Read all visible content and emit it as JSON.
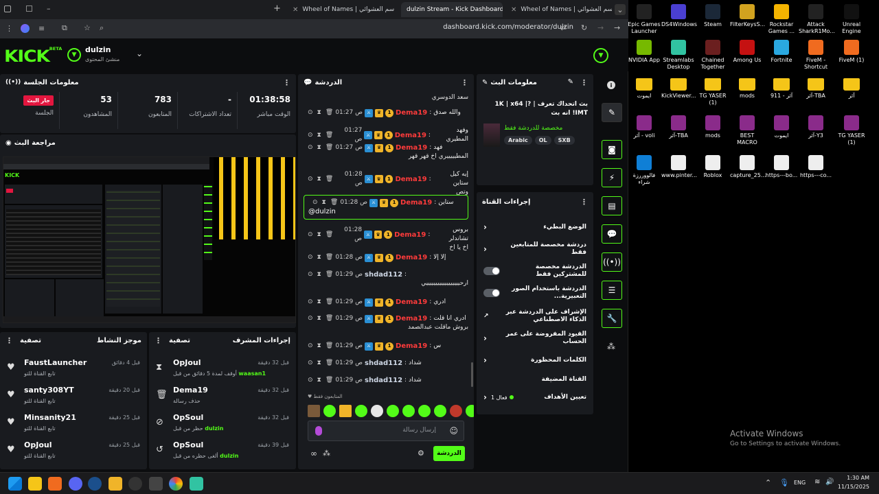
{
  "browser": {
    "tabs": [
      {
        "title": "Wheel of Names | سم العشوائي",
        "active": false
      },
      {
        "title": "dulzin Stream - Kick Dashboard",
        "active": true
      },
      {
        "title": "Wheel of Names | سم العشوائي",
        "active": false
      }
    ],
    "url": "dashboard.kick.com/moderator/dulzin"
  },
  "header": {
    "logo": "KICK",
    "logo_sup": "BETA",
    "channel": "dulzin",
    "role": "منشئ المحتوى"
  },
  "session": {
    "title": "معلومات الجلسة",
    "stats": [
      {
        "value": "01:38:58",
        "label": "الوقت مباشر"
      },
      {
        "value": "-",
        "label": "تعداد الاشتراكات"
      },
      {
        "value": "783",
        "label": "المتابعون"
      },
      {
        "value": "53",
        "label": "المشاهدون"
      },
      {
        "value": "جار البث",
        "label": "الجلسة"
      }
    ]
  },
  "preview": {
    "title": "مراجعة البث"
  },
  "activity": {
    "title": "موجز النشاط",
    "filter": "تصفية",
    "items": [
      {
        "name": "FaustLauncher",
        "sub": "تابع القناة للتو",
        "time": "قبل 4 دقائق",
        "icon": "heart-icon"
      },
      {
        "name": "santy308YT",
        "sub": "تابع القناة للتو",
        "time": "قبل 20 دقيقة",
        "icon": "heart-icon"
      },
      {
        "name": "Minsanity21",
        "sub": "تابع القناة للتو",
        "time": "قبل 25 دقيقة",
        "icon": "heart-icon"
      },
      {
        "name": "OpJoul",
        "sub": "تابع القناة للتو",
        "time": "قبل 25 دقيقة",
        "icon": "heart-icon"
      }
    ]
  },
  "mod": {
    "title": "إجراءات المشرف",
    "filter": "تصفية",
    "items": [
      {
        "name": "OpJoul",
        "sub": "أوقف لمدة 5 دقائق من قبل",
        "target": "waasan1",
        "time": "قبل 32 دقيقة",
        "icon": "hourglass-icon"
      },
      {
        "name": "Dema19",
        "sub": "حذف رسالة",
        "target": "",
        "time": "قبل 32 دقيقة",
        "icon": "trash-icon"
      },
      {
        "name": "OpSoul",
        "sub": "حظر من قبل",
        "target": "dulzin",
        "time": "قبل 32 دقيقة",
        "icon": "ban-icon"
      },
      {
        "name": "OpSoul",
        "sub": "ألغى حظره من قبل",
        "target": "dulzin",
        "time": "قبل 39 دقيقة",
        "icon": "undo-icon"
      }
    ]
  },
  "chat": {
    "title": "الدردشة",
    "top_text": "سعد الدوسري",
    "messages": [
      {
        "user": "Dema19",
        "color": "#ff3b3b",
        "time": "01:27 ص",
        "text": "والله صدق",
        "badges": true
      },
      {
        "user": "Dema19",
        "color": "#ff3b3b",
        "time": "01:27 ص",
        "text": "وفهد المطيري",
        "badges": true
      },
      {
        "user": "Dema19",
        "color": "#ff3b3b",
        "time": "01:27 ص",
        "text": "فهد",
        "cont": "المطيييييري اخ قهر قهر",
        "badges": true
      },
      {
        "user": "Dema19",
        "color": "#ff3b3b",
        "time": "01:28 ص",
        "text": "إيه كيل ستاين",
        "cont": "وتص",
        "badges": true
      },
      {
        "user": "Dema19",
        "color": "#ff3b3b",
        "time": "01:28 ص",
        "text": "ستاين",
        "cont": "@dulzin",
        "badges": true,
        "highlight": true
      },
      {
        "user": "Dema19",
        "color": "#ff3b3b",
        "time": "01:28 ص",
        "text": "بروس تشاندلر",
        "cont": "اخ يا اخ",
        "badges": true
      },
      {
        "user": "Dema19",
        "color": "#ff3b3b",
        "time": "01:28 ص",
        "text": "إلا إلا",
        "badges": true
      },
      {
        "user": "shdad112",
        "color": "#cfd8e6",
        "time": "01:29 ص",
        "text": "",
        "cont": "ارحييييييييييييييييييي",
        "badges": false
      },
      {
        "user": "Dema19",
        "color": "#ff3b3b",
        "time": "01:29 ص",
        "text": "ادري",
        "badges": true
      },
      {
        "user": "Dema19",
        "color": "#ff3b3b",
        "time": "01:29 ص",
        "text": "ادري انا قلت",
        "cont": "بروش ماقلت عبدالصمد",
        "badges": true
      },
      {
        "user": "Dema19",
        "color": "#ff3b3b",
        "time": "01:29 ص",
        "text": "س",
        "badges": true
      },
      {
        "user": "shdad112",
        "color": "#cfd8e6",
        "time": "01:29 ص",
        "text": "شداد",
        "badges": false
      },
      {
        "user": "shdad112",
        "color": "#cfd8e6",
        "time": "01:29 ص",
        "text": "شداد",
        "badges": false
      }
    ],
    "followers_only": "المتابعون فقط",
    "placeholder": "إرسال رسالة",
    "send": "الدردشة"
  },
  "stream_info": {
    "title": "معلومات البث",
    "stream_title": "بث اتحداك تعرف | ?1K | x64 | IMT! انه بث",
    "category": "مخصصة للدردشة فقط",
    "tags": [
      "Arabic",
      "OL",
      "SXB"
    ]
  },
  "channel_actions": {
    "title": "إجراءات القناة",
    "rows": [
      {
        "label": "الوضع البطيء",
        "type": "arrow"
      },
      {
        "label": "دردشة مخصصة للمتابعين فقط",
        "type": "arrow"
      },
      {
        "label": "الدردشة مخصصة للمشتركين فقط",
        "type": "toggle"
      },
      {
        "label": "الدردشة باستخدام الصور التعبيرية...",
        "type": "toggle"
      },
      {
        "label": "الإشراف على الدردشة عبر الذكاء الاصطناعي",
        "type": "ext"
      },
      {
        "label": "القيود المفروضة على عمر الحساب",
        "type": "arrow"
      },
      {
        "label": "الكلمات المحظورة",
        "type": "arrow"
      },
      {
        "label": "القناة المضيفة",
        "type": "none"
      },
      {
        "label": "تعيين الأهداف",
        "type": "arrow",
        "extra": "فعال 1"
      }
    ]
  },
  "desktop": {
    "icons": [
      {
        "label": "Epic Games Launcher",
        "color": "#222"
      },
      {
        "label": "DS4Windows",
        "color": "#4a3fd1"
      },
      {
        "label": "Steam",
        "color": "#1b2838"
      },
      {
        "label": "FilterKeysS...",
        "color": "#d1a21f"
      },
      {
        "label": "Rockstar Games ...",
        "color": "#f5b400"
      },
      {
        "label": "Attack SharkR1Mo...",
        "color": "#222"
      },
      {
        "label": "Unreal Engine",
        "color": "#111"
      },
      {
        "label": "NVIDIA App",
        "color": "#76b900"
      },
      {
        "label": "Streamlabs Desktop",
        "color": "#31c3a2"
      },
      {
        "label": "Chained Together",
        "color": "#6b1f1f"
      },
      {
        "label": "Among Us",
        "color": "#c51111"
      },
      {
        "label": "Fortnite",
        "color": "#2aa8e0"
      },
      {
        "label": "FiveM - Shortcut",
        "color": "#f06b1f"
      },
      {
        "label": "FiveM (1)",
        "color": "#f06b1f"
      },
      {
        "label": "ايموت",
        "color": "folder"
      },
      {
        "label": "KickViewer...",
        "color": "folder"
      },
      {
        "label": "TG YASER (1)",
        "color": "folder"
      },
      {
        "label": "mods",
        "color": "folder"
      },
      {
        "label": "آثر - 911",
        "color": "folder"
      },
      {
        "label": "آثر-TBA",
        "color": "folder"
      },
      {
        "label": "آثر",
        "color": "folder"
      },
      {
        "label": "آثر - voli",
        "color": "#8a2b8a"
      },
      {
        "label": "آثر-TBA",
        "color": "#8a2b8a"
      },
      {
        "label": "mods",
        "color": "#8a2b8a"
      },
      {
        "label": "BEST MACRO",
        "color": "#8a2b8a"
      },
      {
        "label": "ايموت",
        "color": "#8a2b8a"
      },
      {
        "label": "آثر-Y3",
        "color": "#8a2b8a"
      },
      {
        "label": "TG YASER (1)",
        "color": "#8a2b8a"
      },
      {
        "label": "فالووررزة شراء",
        "color": "#0f7fd6"
      },
      {
        "label": "www.pinter...",
        "color": "#eee"
      },
      {
        "label": "Roblox",
        "color": "#eee"
      },
      {
        "label": "capture_25...",
        "color": "#eee"
      },
      {
        "label": "https---bo...",
        "color": "#eee"
      },
      {
        "label": "https---co...",
        "color": "#eee"
      }
    ],
    "activate_title": "Activate Windows",
    "activate_sub": "Go to Settings to activate Windows."
  },
  "taskbar": {
    "lang": "ENG",
    "time": "1:30 AM",
    "date": "11/15/2025"
  }
}
